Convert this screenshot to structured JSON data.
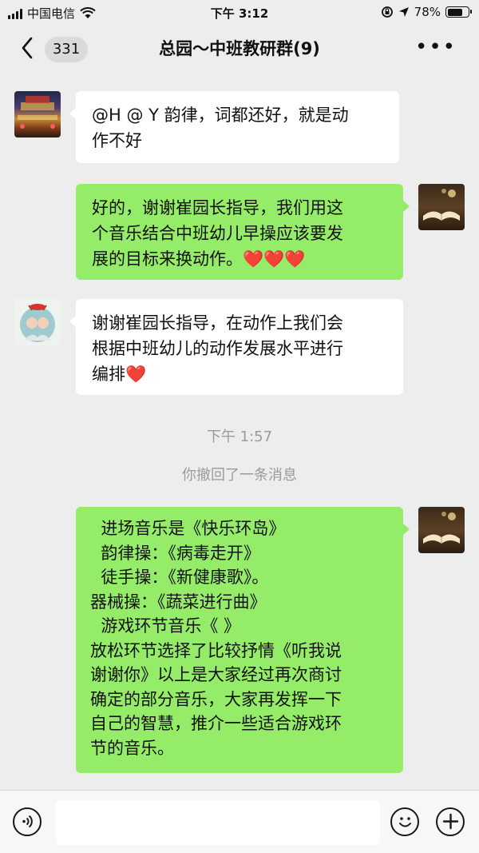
{
  "status_bar": {
    "carrier": "中国电信",
    "time": "下午 3:12",
    "battery": "78%",
    "battery_level": 0.78
  },
  "header": {
    "unread_count": "331",
    "title": "总园～中班教研群(9)",
    "more_label": "•••"
  },
  "messages": [
    {
      "side": "left",
      "text": "@H @ Y 韵律，词都还好，就是动\n作不好"
    },
    {
      "side": "right",
      "text": "好的，谢谢崔园长指导，我们用这\n个音乐结合中班幼儿早操应该要发\n展的目标来换动作。❤️❤️❤️"
    },
    {
      "side": "left",
      "text": "谢谢崔园长指导，在动作上我们会\n根据中班幼儿的动作发展水平进行\n编排❤️"
    },
    {
      "side": "right",
      "text": "  进场音乐是《快乐环岛》\n  韵律操：《病毒走开》\n  徒手操：《新健康歌》。\n器械操：《蔬菜进行曲》\n  游戏环节音乐《 》\n放松环节选择了比较抒情《听我说\n谢谢你》以上是大家经过再次商讨\n确定的部分音乐，大家再发挥一下\n自己的智慧，推介一些适合游戏环\n节的音乐。"
    }
  ],
  "system": {
    "timestamp": "下午 1:57",
    "recall_notice": "你撤回了一条消息"
  },
  "input": {
    "placeholder": ""
  },
  "colors": {
    "background": "#ededed",
    "my_bubble": "#95ec69",
    "other_bubble": "#ffffff"
  }
}
